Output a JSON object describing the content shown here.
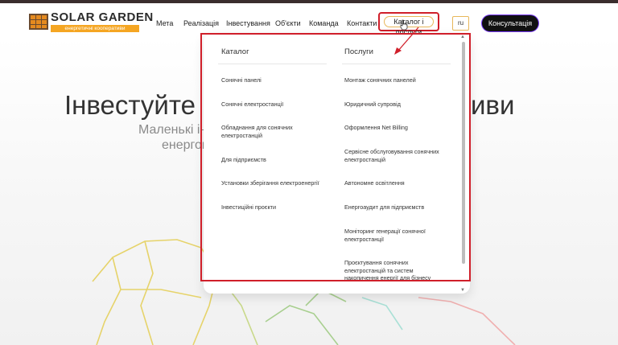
{
  "brand": {
    "title": "SOLAR GARDEN",
    "subtitle": "енергетичні кооперативи",
    "colors": {
      "accent": "#f5a623",
      "dark": "#111111",
      "highlight": "#d01f2a"
    }
  },
  "nav": {
    "items": [
      "Мета",
      "Реалізація",
      "Інвестування",
      "Об'єкти",
      "Команда",
      "Контакти"
    ],
    "catalog_label": "Каталог і послуги",
    "lang": "ru",
    "cta": "Консультація"
  },
  "hero": {
    "title_left": "Інвестуйте в",
    "title_right": "иви",
    "sub1": "Маленькі ін",
    "sub2": "енергок"
  },
  "dropdown": {
    "catalog": {
      "heading": "Каталог",
      "items": [
        "Сонячні панелі",
        "Сонячні електростанції",
        "Обладнання для сонячних електростанцій",
        "Для підприємств",
        "Установки зберігання електроенергії",
        "Інвестиційні проєкти"
      ]
    },
    "services": {
      "heading": "Послуги",
      "items": [
        "Монтаж сонячних панелей",
        "Юридичний супровід",
        "Оформлення Net Billing",
        "Сервісне обслуговування сонячних електростанцій",
        "Автономне освітлення",
        "Енергоаудит для підприємств",
        "Моніторинг генерації сонячної електростанції",
        "Проєктування сонячних електростанцій та систем накопичення енергії для бізнесу"
      ]
    }
  },
  "icons": {
    "logo": "solar-panel-icon",
    "scroll_up": "scroll-up-arrow-icon",
    "scroll_down": "scroll-down-arrow-icon",
    "cursor": "hand-cursor-icon",
    "annotation": "red-arrow-icon"
  }
}
